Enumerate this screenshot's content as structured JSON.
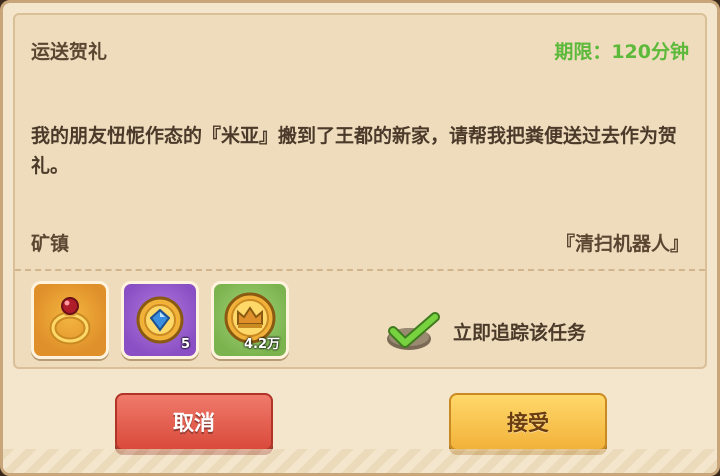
{
  "quest": {
    "title": "运送贺礼",
    "deadline": "期限：120分钟",
    "description": "我的朋友忸怩作态的『米亚』搬到了王都的新家，请帮我把粪便送过去作为贺礼。",
    "location": "矿镇",
    "client": "『清扫机器人』"
  },
  "rewards": [
    {
      "icon": "ruby-ring-icon",
      "quantity": ""
    },
    {
      "icon": "blue-gem-medal-icon",
      "quantity": "5"
    },
    {
      "icon": "gold-crown-coin-icon",
      "quantity": "4.2万"
    }
  ],
  "track": {
    "label": "立即追踪该任务",
    "checked": true
  },
  "buttons": {
    "cancel": "取消",
    "accept": "接受"
  },
  "colors": {
    "deadline_green": "#5cb93a",
    "cancel_red": "#d94a3b",
    "accept_gold": "#f2b23a"
  }
}
